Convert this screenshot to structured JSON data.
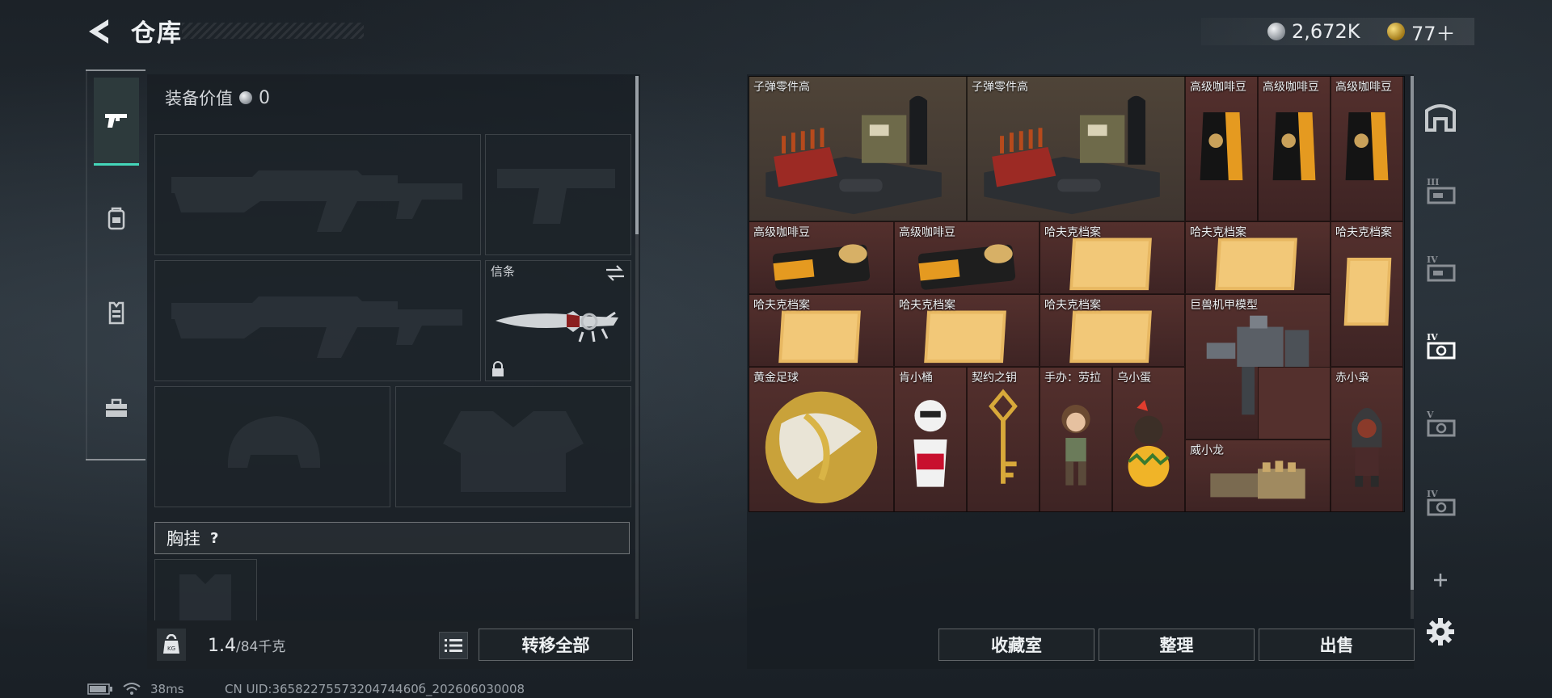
{
  "header": {
    "title": "仓库",
    "currency_silver": "2,672K",
    "currency_gold": "77＋"
  },
  "left_tabs": [
    {
      "icon": "pistol-icon",
      "active": true
    },
    {
      "icon": "backpack-icon",
      "active": false
    },
    {
      "icon": "vest-icon",
      "active": false
    },
    {
      "icon": "toolbox-icon",
      "active": false
    }
  ],
  "equipment": {
    "value_label": "装备价值",
    "value_number": "0",
    "melee_label": "信条",
    "chest_label": "胸挂",
    "chest_help": "?"
  },
  "weight": {
    "current": "1.4",
    "max": "/84千克"
  },
  "buttons": {
    "transfer_all": "转移全部",
    "collection": "收藏室",
    "sort": "整理",
    "sell": "出售"
  },
  "status_bar": {
    "ping": "38ms",
    "uid": "CN UID:3658227557320474460б_202606030008"
  },
  "storage_items": [
    {
      "label": "子弹零件高",
      "bg": "brown",
      "icon": "ammo-crate-icon"
    },
    {
      "label": "子弹零件高",
      "bg": "brown",
      "icon": "ammo-crate-icon"
    },
    {
      "label": "高级咖啡豆",
      "bg": "red",
      "icon": "coffee-bag-icon"
    },
    {
      "label": "高级咖啡豆",
      "bg": "red",
      "icon": "coffee-bag-icon"
    },
    {
      "label": "高级咖啡豆",
      "bg": "red",
      "icon": "coffee-bag-icon"
    },
    {
      "label": "高级咖啡豆",
      "bg": "red",
      "icon": "coffee-tin-icon"
    },
    {
      "label": "高级咖啡豆",
      "bg": "red",
      "icon": "coffee-tin-icon"
    },
    {
      "label": "哈夫克档案",
      "bg": "red",
      "icon": "folder-icon"
    },
    {
      "label": "哈夫克档案",
      "bg": "red",
      "icon": "folder-icon"
    },
    {
      "label": "哈夫克档案",
      "bg": "red",
      "icon": "folder-icon"
    },
    {
      "label": "哈夫克档案",
      "bg": "red",
      "icon": "folder-icon"
    },
    {
      "label": "哈夫克档案",
      "bg": "red",
      "icon": "folder-icon"
    },
    {
      "label": "哈夫克档案",
      "bg": "red",
      "icon": "folder-icon"
    },
    {
      "label": "巨兽机甲模型",
      "bg": "red",
      "icon": "mech-model-icon"
    },
    {
      "label": "黄金足球",
      "bg": "red",
      "icon": "golden-football-icon"
    },
    {
      "label": "肯小桶",
      "bg": "red",
      "icon": "kfc-figure-icon"
    },
    {
      "label": "契约之钥",
      "bg": "red",
      "icon": "golden-key-icon"
    },
    {
      "label": "手办：劳拉",
      "bg": "red",
      "icon": "lara-figure-icon"
    },
    {
      "label": "乌小蛋",
      "bg": "red",
      "icon": "egg-figure-icon"
    },
    {
      "label": "赤小枭",
      "bg": "red",
      "icon": "owl-figure-icon"
    },
    {
      "label": "威小龙",
      "bg": "red",
      "icon": "gauntlet-icon"
    }
  ],
  "right_rail": [
    {
      "icon": "safe-box-icon"
    },
    {
      "icon": "case-iii-icon"
    },
    {
      "icon": "case-iv-icon"
    },
    {
      "icon": "case-iv-active-icon"
    },
    {
      "icon": "case-v-icon"
    },
    {
      "icon": "case-iv-b-icon"
    },
    {
      "icon": "plus-icon"
    },
    {
      "icon": "settings-gear-icon"
    }
  ],
  "colors": {
    "accent": "#44d6b9",
    "cell_brown": "#4f4438",
    "cell_red": "#54302d"
  }
}
